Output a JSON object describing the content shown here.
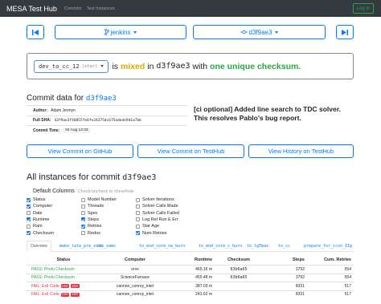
{
  "nav": {
    "brand": "MESA Test Hub",
    "links": [
      "Commits",
      "Test Instances"
    ],
    "login": "Log In"
  },
  "selector_bar": {
    "prev": "⏮",
    "branch": "jenkins",
    "branch_icon": "git-branch-icon",
    "commit": "d3f9ae3",
    "commit_icon": "git-commit-icon",
    "next": "⏭"
  },
  "status": {
    "branch_select": "dev_to_cc_12",
    "star": "(star)",
    "is": "is",
    "mixed": "mixed",
    "in": "in",
    "sha": "d3f9ae3",
    "with": "with",
    "unique": "one unique checksum."
  },
  "commit_data": {
    "heading": "Commit data for",
    "sha": "d3f9ae3",
    "author_label": "Author:",
    "author": "Adam Jermyn",
    "full_sha_label": "Full SHA:",
    "full_sha": "d3f9ae3f48855fe6fe34375dcb75adede9d1a7bb",
    "time_label": "Commit Time:",
    "time": "04 Aug 12:33",
    "message": "[ci optional] Added line search to TDC solver. This resolves Pablo's bug report."
  },
  "action_buttons": {
    "github": "View Commit on GitHub",
    "testhub": "View Commit on TestHub",
    "history": "View History on TestHub"
  },
  "instances": {
    "heading": "All instances for commit",
    "sha": "d3f9ae3",
    "default_columns": "Default Columns",
    "hint": "Check/uncheck to show/hide",
    "columns": [
      {
        "label": "Status",
        "checked": true
      },
      {
        "label": "Computer",
        "checked": true
      },
      {
        "label": "Date",
        "checked": false
      },
      {
        "label": "Runtime",
        "checked": true
      },
      {
        "label": "Ram",
        "checked": false
      },
      {
        "label": "Checksum",
        "checked": true
      },
      {
        "label": "Model Number",
        "checked": false
      },
      {
        "label": "Threads",
        "checked": false
      },
      {
        "label": "Spec",
        "checked": false
      },
      {
        "label": "Steps",
        "checked": true
      },
      {
        "label": "Retries",
        "checked": true
      },
      {
        "label": "Redos",
        "checked": false
      },
      {
        "label": "Solver Iterations",
        "checked": false
      },
      {
        "label": "Solver Calls Made",
        "checked": false
      },
      {
        "label": "Solver Calls Failed",
        "checked": false
      },
      {
        "label": "Log Rel Run E Err",
        "checked": false
      },
      {
        "label": "Star Age",
        "checked": false
      },
      {
        "label": "Num Retries",
        "checked": true
      }
    ],
    "tabs": [
      "Overview",
      "make_late_pre_zams",
      "to_zams",
      "to_end_core_ne_burn",
      "to_end_core_c_burn",
      "to_lgTmax",
      "to_cc",
      "prepare_for_ccsn_IIp"
    ],
    "table_headers": [
      "Status",
      "Computer",
      "Runtime",
      "Checksum",
      "Steps",
      "Cum. Retries"
    ],
    "rows": [
      {
        "status": "PASS: Photo Checksum",
        "kind": "pass",
        "computer": "orvx",
        "runtime": "465.16 m",
        "checksum": "63b6a65",
        "steps": "3792",
        "retries": "554"
      },
      {
        "status": "PASS: Photo Checksum",
        "kind": "pass",
        "computer": "ScienceFurnace",
        "runtime": "455.48 m",
        "checksum": "63b6a65",
        "steps": "3792",
        "retries": "554"
      },
      {
        "status": "FAIL: Exit Code",
        "kind": "fail",
        "badge1": "ERR",
        "badge2": "ERR",
        "computer": "cannon_conroy_intel",
        "runtime": "387.03 m",
        "checksum": "",
        "steps": "8331",
        "retries": "517"
      },
      {
        "status": "FAIL: Exit Code",
        "kind": "fail",
        "badge1": "ERR",
        "badge2": "ERR",
        "computer": "cannon_conroy_intel",
        "runtime": "243.62 m",
        "checksum": "",
        "steps": "8331",
        "retries": "517"
      }
    ]
  }
}
